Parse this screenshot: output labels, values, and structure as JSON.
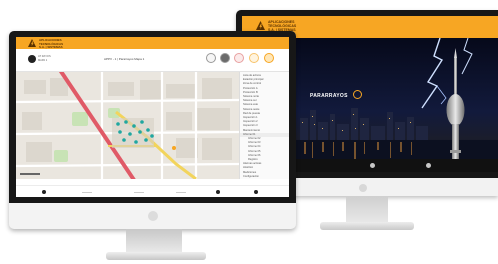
{
  "colors": {
    "accent": "#f7a623",
    "bezel": "#171717",
    "map_bg": "#eae6df",
    "road_red": "#e05a67",
    "road_yellow": "#f2d45c",
    "marker_teal": "#20a7a0"
  },
  "brand": {
    "lines": [
      "APLICACIONES",
      "TECNOLÓGICAS",
      "S.A. | SISTEMAS",
      "PARARRAYOS"
    ]
  },
  "back_screen": {
    "hero_title": "PARARRAYOS",
    "footer_icons": [
      "circle-icon",
      "circle-icon",
      "circle-icon"
    ]
  },
  "front_screen": {
    "toolbar": {
      "title": "APPV - 1 | Pararrayos Mapa 1",
      "left_label_1": "AT RAYOS",
      "left_label_2": "MAPA 1"
    },
    "sidebar": {
      "rows": [
        "Lista de activos",
        "Estación principal",
        "Zona de control",
        "Protección A",
        "Protección B",
        "Sistema norte",
        "Sistema sur",
        "Sistema este",
        "Sistema oeste",
        "Red de puesta",
        "Inspección 1",
        "Inspección 2",
        "Inspección 3",
        "Mantenimiento",
        "Informe 01",
        "Informe 02",
        "Informe 03",
        "Informe 04",
        "Informe 05",
        "Informe 06",
        "Registro",
        "Alarmas activas",
        "Histórico",
        "Mediciones",
        "Configuración"
      ],
      "highlighted_index": 14
    },
    "footer_items": [
      "",
      "",
      "",
      "",
      "",
      ""
    ]
  }
}
